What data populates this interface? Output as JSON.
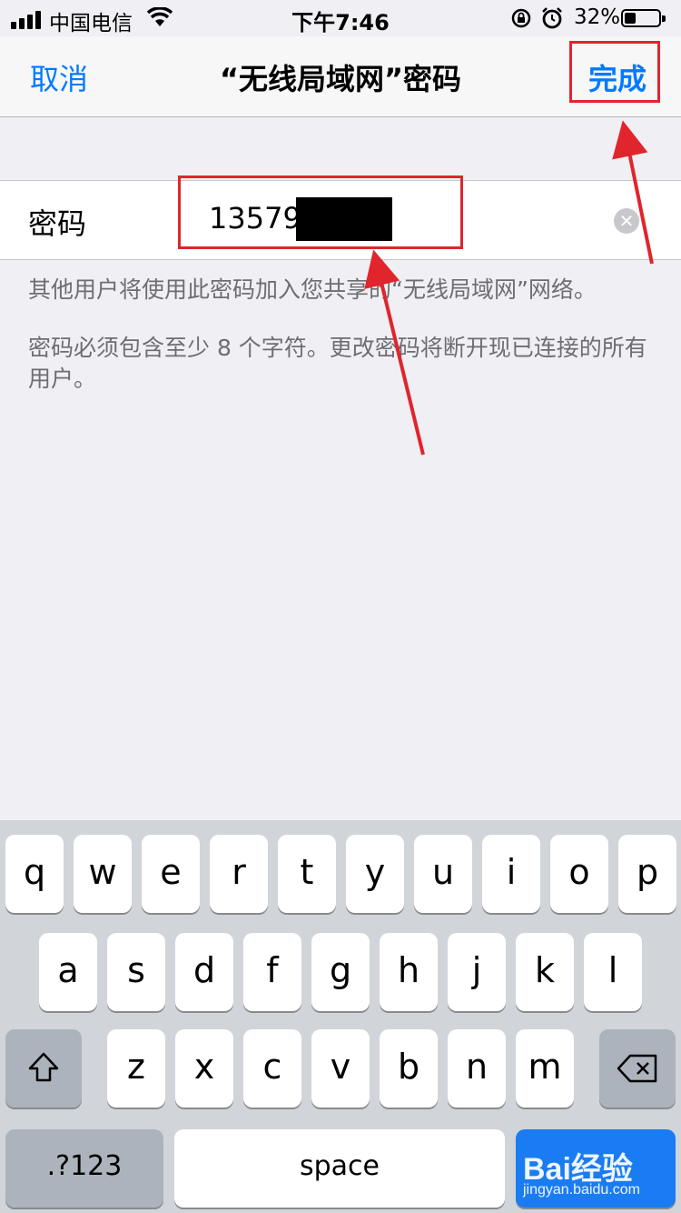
{
  "status_bar": {
    "carrier": "中国电信",
    "time": "下午7:46",
    "battery_percent": "32%",
    "battery_level": 0.32,
    "icons": [
      "signal-icon",
      "wifi-icon",
      "rotation-lock-icon",
      "alarm-icon",
      "battery-icon"
    ]
  },
  "nav": {
    "cancel_label": "取消",
    "title": "“无线局域网”密码",
    "done_label": "完成"
  },
  "password_row": {
    "label": "密码",
    "value": "13579"
  },
  "notes": {
    "line1": "其他用户将使用此密码加入您共享的“无线局域网”网络。",
    "line2": "密码必须包含至少 8 个字符。更改密码将断开现已连接的所有用户。"
  },
  "keyboard": {
    "row1": [
      "q",
      "w",
      "e",
      "r",
      "t",
      "y",
      "u",
      "i",
      "o",
      "p"
    ],
    "row2": [
      "a",
      "s",
      "d",
      "f",
      "g",
      "h",
      "j",
      "k",
      "l"
    ],
    "row3": [
      "z",
      "x",
      "c",
      "v",
      "b",
      "n",
      "m"
    ],
    "numbers_label": ".?123",
    "space_label": "space"
  },
  "watermark": {
    "logo": "Bai经验",
    "url": "jingyan.baidu.com"
  },
  "colors": {
    "accent": "#007aff",
    "annotation": "#e0252d",
    "background": "#efeff4"
  }
}
